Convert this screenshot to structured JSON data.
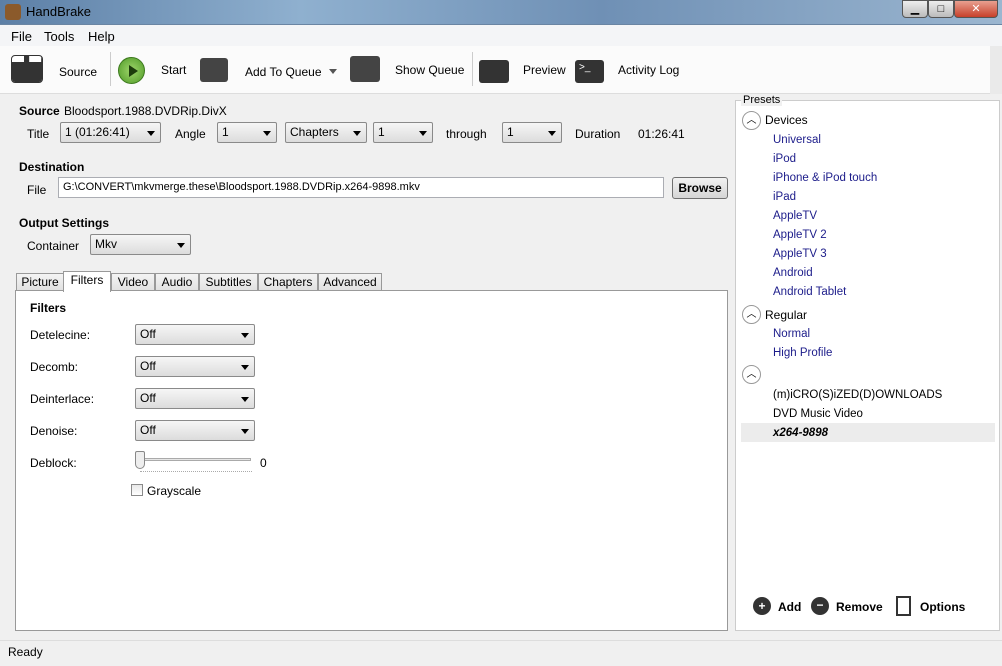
{
  "window": {
    "title": "HandBrake"
  },
  "menu": [
    "File",
    "Tools",
    "Help"
  ],
  "toolbar": {
    "source": "Source",
    "start": "Start",
    "add_to_queue": "Add To Queue",
    "show_queue": "Show Queue",
    "preview": "Preview",
    "activity_log": "Activity Log"
  },
  "source": {
    "label": "Source",
    "value": "Bloodsport.1988.DVDRip.DivX",
    "title_label": "Title",
    "title_value": "1 (01:26:41)",
    "angle_label": "Angle",
    "angle_value": "1",
    "range_mode": "Chapters",
    "range_start": "1",
    "through_label": "through",
    "range_end": "1",
    "duration_label": "Duration",
    "duration_value": "01:26:41"
  },
  "destination": {
    "label": "Destination",
    "file_label": "File",
    "file_value": "G:\\CONVERT\\mkvmerge.these\\Bloodsport.1988.DVDRip.x264-9898.mkv",
    "browse": "Browse"
  },
  "output": {
    "label": "Output Settings",
    "container_label": "Container",
    "container_value": "Mkv"
  },
  "tabs": [
    "Picture",
    "Filters",
    "Video",
    "Audio",
    "Subtitles",
    "Chapters",
    "Advanced"
  ],
  "filters": {
    "heading": "Filters",
    "detelecine_label": "Detelecine:",
    "detelecine": "Off",
    "decomb_label": "Decomb:",
    "decomb": "Off",
    "deinterlace_label": "Deinterlace:",
    "deinterlace": "Off",
    "denoise_label": "Denoise:",
    "denoise": "Off",
    "deblock_label": "Deblock:",
    "deblock_value": "0",
    "grayscale_label": "Grayscale",
    "grayscale_checked": false
  },
  "presets": {
    "title": "Presets",
    "groups": [
      {
        "name": "Devices",
        "items": [
          "Universal",
          "iPod",
          "iPhone & iPod touch",
          "iPad",
          "AppleTV",
          "AppleTV 2",
          "AppleTV 3",
          "Android",
          "Android Tablet"
        ]
      },
      {
        "name": "Regular",
        "items": [
          "Normal",
          "High Profile"
        ]
      },
      {
        "name": "",
        "items": [
          "(m)iCRO(S)iZED(D)OWNLOADS",
          "DVD Music Video",
          "x264-9898"
        ]
      }
    ],
    "selected": "x264-9898",
    "add": "Add",
    "remove": "Remove",
    "options": "Options"
  },
  "status": "Ready"
}
